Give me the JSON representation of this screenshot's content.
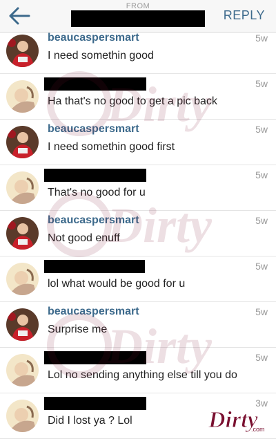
{
  "header": {
    "from_label": "FROM",
    "reply_label": "REPLY",
    "accent_color": "#3d6a8c"
  },
  "messages": [
    {
      "sender": "beaucaspersmart",
      "redacted": false,
      "text": "I need somethin good",
      "time": "5w",
      "avatar": "red-shirt"
    },
    {
      "sender": "",
      "redacted": true,
      "text": "Ha that's no good to get a pic back",
      "time": "5w",
      "avatar": "light"
    },
    {
      "sender": "beaucaspersmart",
      "redacted": false,
      "text": "I need somethin good first",
      "time": "5w",
      "avatar": "red-shirt"
    },
    {
      "sender": "",
      "redacted": true,
      "text": "That's no good for u",
      "time": "5w",
      "avatar": "light"
    },
    {
      "sender": "beaucaspersmart",
      "redacted": false,
      "text": "Not good enuff",
      "time": "5w",
      "avatar": "red-shirt"
    },
    {
      "sender": "",
      "redacted": true,
      "text": "lol what would be good for u",
      "time": "5w",
      "avatar": "light"
    },
    {
      "sender": "beaucaspersmart",
      "redacted": false,
      "text": "Surprise me",
      "time": "5w",
      "avatar": "red-shirt"
    },
    {
      "sender": "",
      "redacted": true,
      "text": "Lol no sending anything else till you do",
      "time": "5w",
      "avatar": "light"
    },
    {
      "sender": "",
      "redacted": true,
      "text": "Did I lost ya ? Lol",
      "time": "3w",
      "avatar": "light"
    }
  ],
  "watermark": {
    "logo_text": "theDirty",
    "site": ".com"
  }
}
